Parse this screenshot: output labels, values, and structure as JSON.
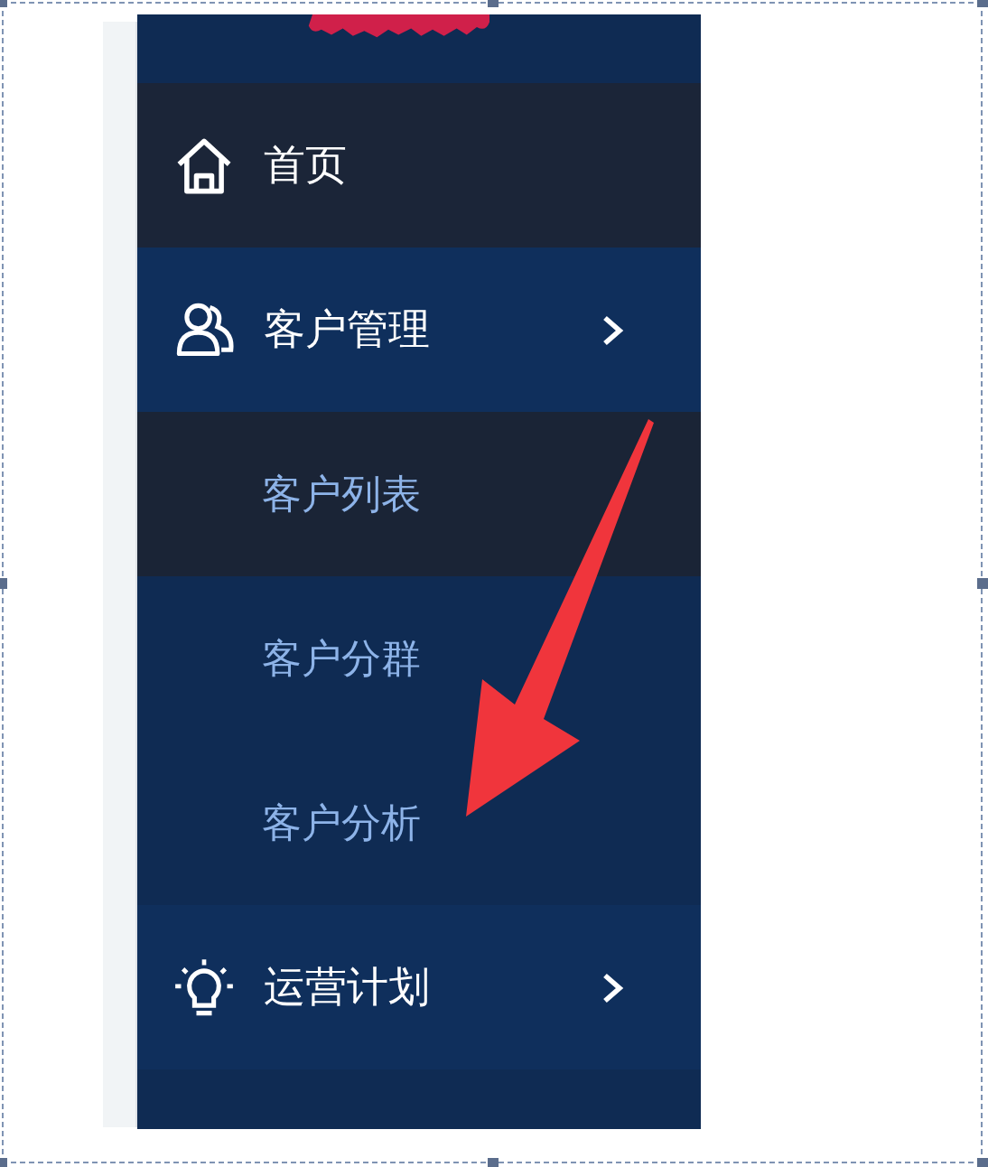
{
  "sidebar": {
    "items": [
      {
        "kind": "link",
        "label": "首页",
        "selected": true
      },
      {
        "kind": "group",
        "label": "客户管理",
        "expanded": true,
        "selected": false,
        "children": [
          {
            "label": "客户列表",
            "selected": true
          },
          {
            "label": "客户分群",
            "selected": false
          },
          {
            "label": "客户分析",
            "selected": false
          }
        ]
      },
      {
        "kind": "group",
        "label": "运营计划",
        "expanded": false,
        "selected": false
      }
    ]
  }
}
